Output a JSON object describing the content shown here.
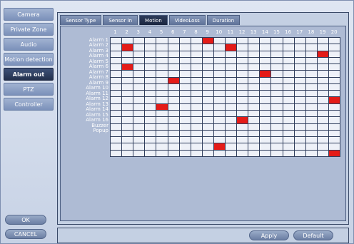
{
  "sidebar": {
    "items": [
      {
        "label": "Camera",
        "active": false
      },
      {
        "label": "Private Zone",
        "active": false
      },
      {
        "label": "Audio",
        "active": false
      },
      {
        "label": "Motion detection",
        "active": false
      },
      {
        "label": "Alarm out",
        "active": true
      },
      {
        "label": "PTZ",
        "active": false
      },
      {
        "label": "Controller",
        "active": false
      }
    ],
    "ok_label": "OK",
    "cancel_label": "CANCEL"
  },
  "tabs": [
    {
      "label": "Sensor Type",
      "active": false
    },
    {
      "label": "Sensor In",
      "active": false
    },
    {
      "label": "Motion",
      "active": true
    },
    {
      "label": "VideoLoss",
      "active": false
    },
    {
      "label": "Duration",
      "active": false
    }
  ],
  "grid": {
    "columns": [
      "1",
      "2",
      "3",
      "4",
      "5",
      "6",
      "7",
      "8",
      "9",
      "10",
      "11",
      "12",
      "13",
      "14",
      "15",
      "16",
      "17",
      "18",
      "19",
      "20"
    ],
    "rows": [
      {
        "label": "Alarm 1",
        "on": [
          9
        ]
      },
      {
        "label": "Alarm 2",
        "on": [
          2,
          11
        ]
      },
      {
        "label": "Alarm 3",
        "on": [
          19
        ]
      },
      {
        "label": "Alarm 4",
        "on": []
      },
      {
        "label": "Alarm 5",
        "on": [
          2
        ]
      },
      {
        "label": "Alarm 6",
        "on": [
          14
        ]
      },
      {
        "label": "Alarm 7",
        "on": [
          6
        ]
      },
      {
        "label": "Alarm 8",
        "on": []
      },
      {
        "label": "Alarm 9",
        "on": []
      },
      {
        "label": "Alarm 10",
        "on": [
          20
        ]
      },
      {
        "label": "Alarm 11",
        "on": [
          5
        ]
      },
      {
        "label": "Alarm 12",
        "on": []
      },
      {
        "label": "Alarm 13",
        "on": [
          12
        ]
      },
      {
        "label": "Alarm 14",
        "on": []
      },
      {
        "label": "Alarm 15",
        "on": []
      },
      {
        "label": "Alarm 16",
        "on": []
      },
      {
        "label": "Buzzer",
        "on": [
          10
        ]
      },
      {
        "label": "Popup",
        "on": [
          20
        ]
      }
    ],
    "active_color": "#e41b17",
    "inactive_color": "#eef1f8"
  },
  "footer": {
    "apply_label": "Apply",
    "default_label": "Default"
  }
}
